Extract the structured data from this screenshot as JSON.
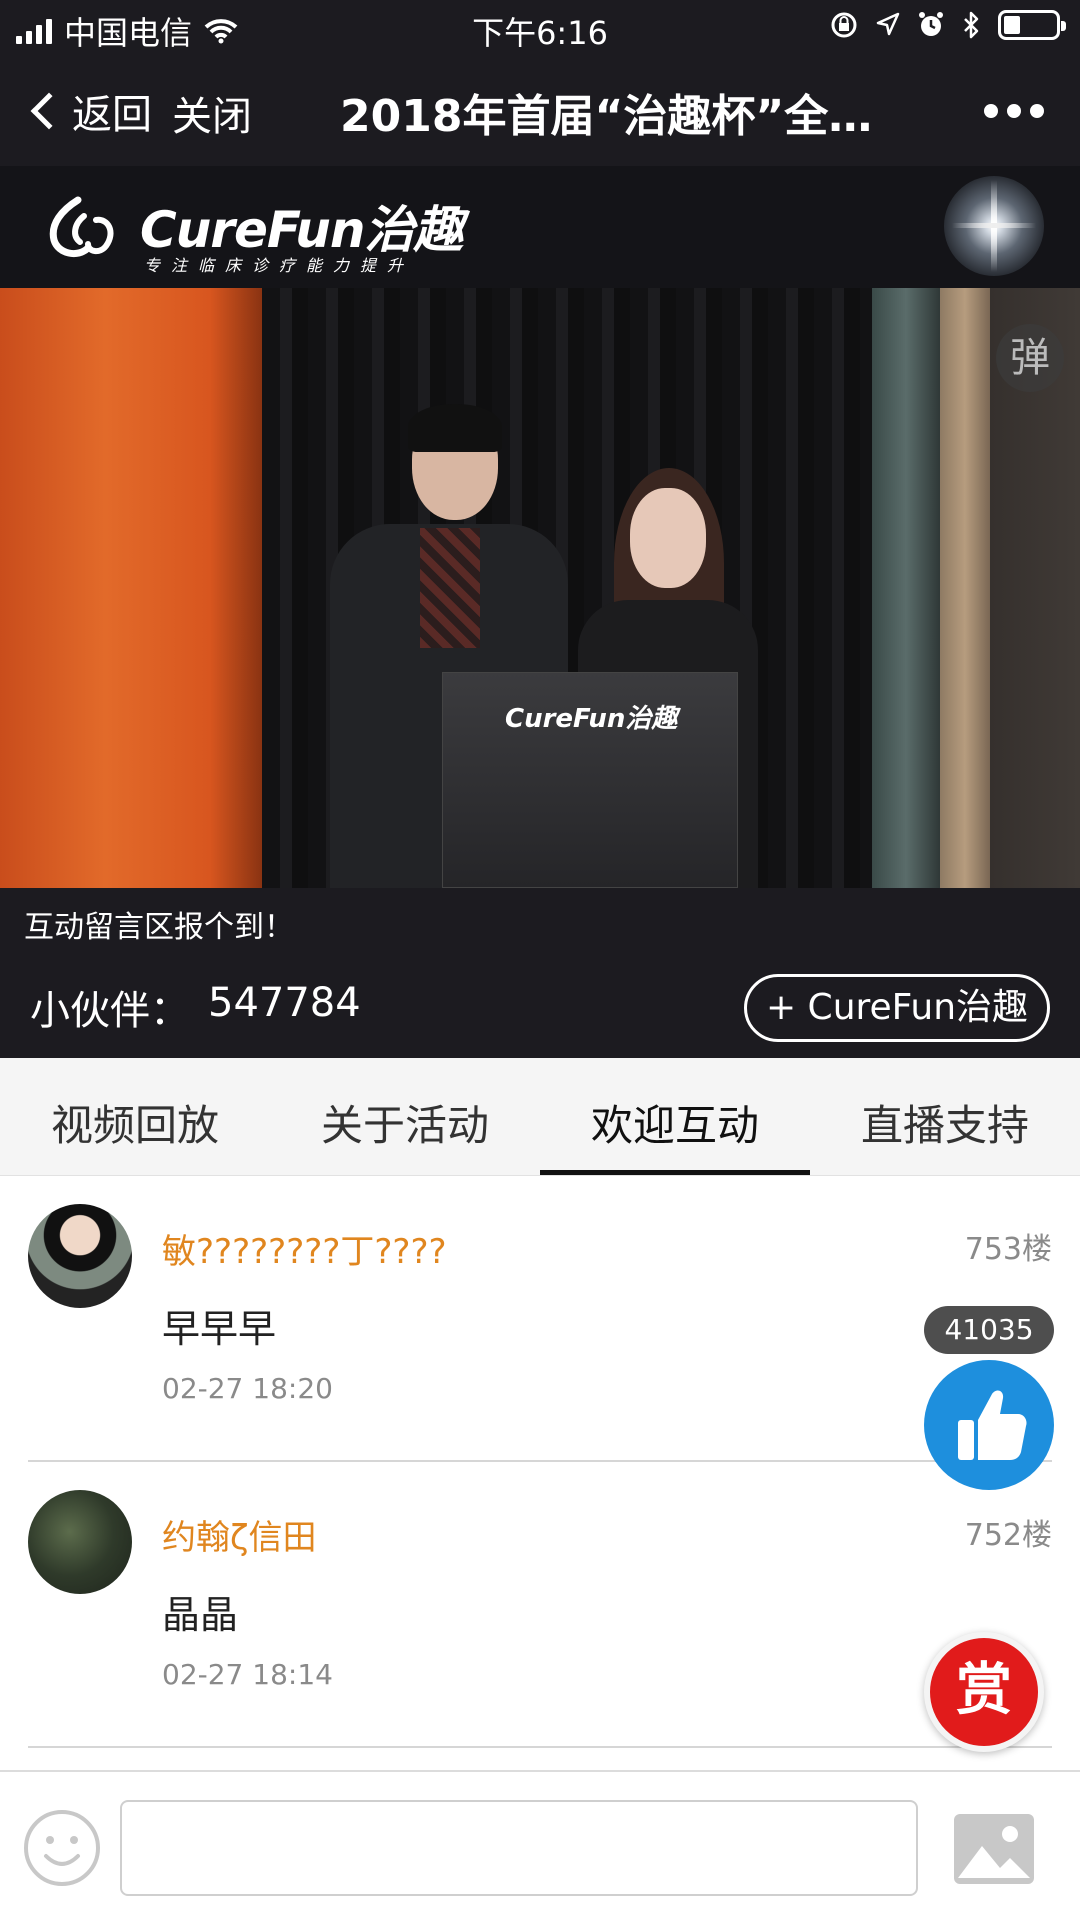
{
  "status": {
    "carrier": "中国电信",
    "time": "下午6:16"
  },
  "nav": {
    "back_label": "返回",
    "close_label": "关闭",
    "title": "2018年首届“治趣杯”全…"
  },
  "brand": {
    "name": "CureFun治趣",
    "tagline": "专注临床诊疗能力提升"
  },
  "video": {
    "danmu_label": "弹",
    "podium_text": "CureFun治趣"
  },
  "ticker": "互动留言区报个到！",
  "stats": {
    "label": "小伙伴：",
    "count": "547784",
    "follow_label": "+ CureFun治趣"
  },
  "tabs": [
    {
      "label": "视频回放"
    },
    {
      "label": "关于活动"
    },
    {
      "label": "欢迎互动"
    },
    {
      "label": "直播支持"
    }
  ],
  "comments": [
    {
      "name": "敏????????丁????",
      "floor": "753楼",
      "text": "早早早",
      "time": "02-27 18:20"
    },
    {
      "name": "约翰ζ信田",
      "floor": "752楼",
      "text": "晶晶",
      "time": "02-27 18:14"
    }
  ],
  "likes": {
    "count": "41035"
  },
  "reward_label": "赏",
  "colors": {
    "bar_dark": "#1c1b20",
    "name_orange": "#e0861f",
    "like_blue": "#1e8fdd",
    "reward_red": "#e11b1b"
  },
  "icons": [
    "signal-icon",
    "wifi-icon",
    "lock-rotation-icon",
    "location-icon",
    "alarm-icon",
    "bluetooth-icon",
    "battery-icon",
    "back-chevron-icon",
    "more-icon",
    "thumbs-up-icon",
    "emoji-icon",
    "image-icon"
  ]
}
